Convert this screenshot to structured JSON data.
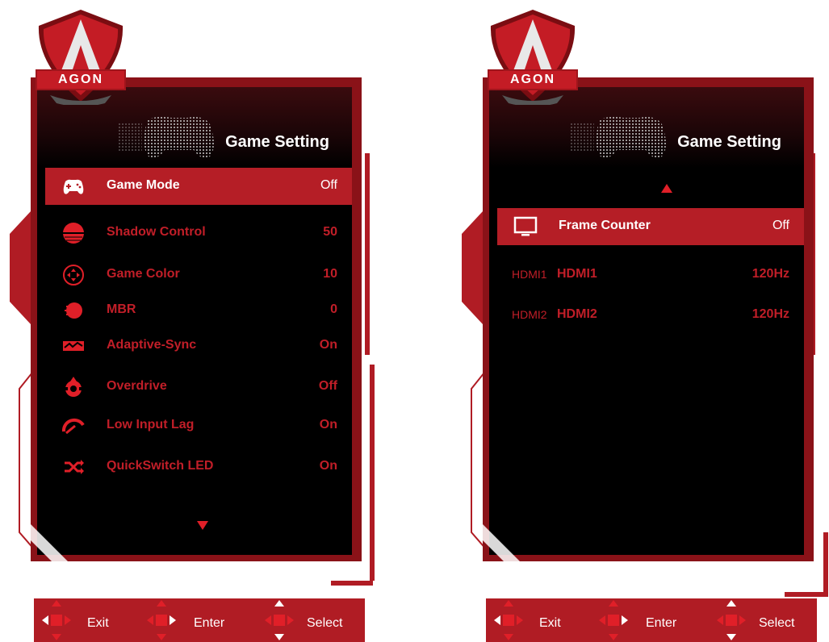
{
  "colors": {
    "accent": "#b51e26",
    "text_inactive": "#c11e28",
    "panel": "#000000",
    "active_text": "#ffffff"
  },
  "brand": {
    "logo_text": "AGON"
  },
  "left_menu": {
    "title": "Game Setting",
    "items": [
      {
        "label": "Game Mode",
        "value": "Off",
        "icon": "gamepad-icon",
        "active": true
      },
      {
        "label": "Shadow Control",
        "value": "50",
        "icon": "shadow-control-icon"
      },
      {
        "label": "Game Color",
        "value": "10",
        "icon": "game-color-icon"
      },
      {
        "label": "MBR",
        "value": "0",
        "icon": "mbr-icon"
      },
      {
        "label": "Adaptive-Sync",
        "value": "On",
        "icon": "adaptive-sync-icon"
      },
      {
        "label": "Overdrive",
        "value": "Off",
        "icon": "overdrive-icon"
      },
      {
        "label": "Low Input Lag",
        "value": "On",
        "icon": "low-input-lag-icon"
      },
      {
        "label": "QuickSwitch LED",
        "value": "On",
        "icon": "shuffle-icon"
      }
    ]
  },
  "right_menu": {
    "title": "Game Setting",
    "items": [
      {
        "label": "Frame Counter",
        "value": "Off",
        "icon": "monitor-icon",
        "active": true
      },
      {
        "tag": "HDMI1",
        "label": "HDMI1",
        "value": "120Hz"
      },
      {
        "tag": "HDMI2",
        "label": "HDMI2",
        "value": "120Hz"
      }
    ]
  },
  "footer": {
    "exit": "Exit",
    "enter": "Enter",
    "select": "Select"
  }
}
